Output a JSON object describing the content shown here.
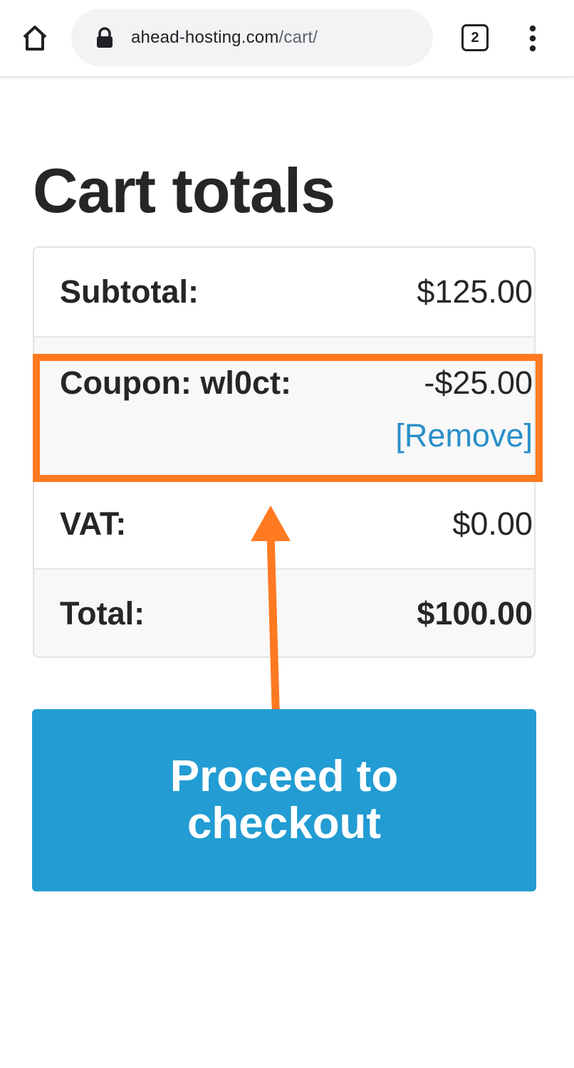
{
  "browser": {
    "url_domain": "ahead-hosting.com",
    "url_path": "/cart/",
    "tab_count": "2",
    "icons": [
      "home-icon",
      "lock-icon",
      "tabs-icon",
      "more-vert-icon"
    ]
  },
  "cart": {
    "title": "Cart totals",
    "subtotal_label": "Subtotal:",
    "subtotal_value": "$125.00",
    "coupon_label": "Coupon: wl0ct:",
    "coupon_value": "-$25.00",
    "coupon_remove": "[Remove]",
    "vat_label": "VAT:",
    "vat_value": "$0.00",
    "total_label": "Total:",
    "total_value": "$100.00",
    "checkout_button": "Proceed to checkout"
  },
  "colors": {
    "annotation": "#ff7a21",
    "button": "#229cd3",
    "link": "#2a8fca"
  }
}
